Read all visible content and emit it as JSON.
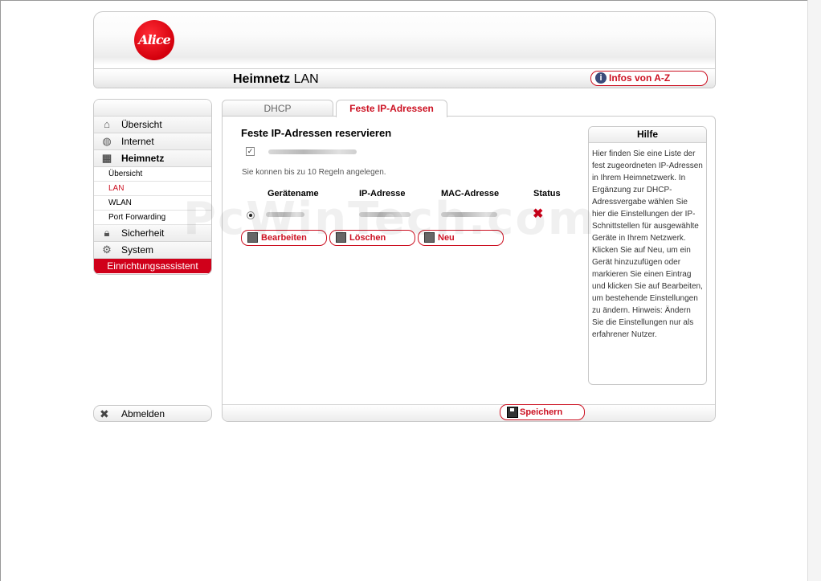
{
  "header": {
    "logo_text": "Alice",
    "title_bold": "Heimnetz",
    "title_rest": " LAN",
    "infos_label": "Infos von A-Z"
  },
  "sidebar": {
    "items": [
      {
        "label": "Übersicht",
        "icon": "home-icon"
      },
      {
        "label": "Internet",
        "icon": "globe-icon"
      },
      {
        "label": "Heimnetz",
        "icon": "network-icon"
      }
    ],
    "subitems": [
      "Übersicht",
      "LAN",
      "WLAN",
      "Port Forwarding"
    ],
    "items2": [
      {
        "label": "Sicherheit",
        "icon": "lock-icon"
      },
      {
        "label": "System",
        "icon": "gear-icon"
      }
    ],
    "wizard_label": "Einrichtungsassistent",
    "logout_label": "Abmelden"
  },
  "tabs": {
    "dhcp": "DHCP",
    "fixed": "Feste IP-Adressen"
  },
  "main": {
    "section_title": "Feste IP-Adressen reservieren",
    "hint": "Sie konnen bis zu 10 Regeln angelegen.",
    "columns": [
      "Gerätename",
      "IP-Adresse",
      "MAC-Adresse",
      "Status"
    ],
    "buttons": {
      "edit": "Bearbeiten",
      "delete": "Löschen",
      "new": "Neu",
      "save": "Speichern"
    }
  },
  "help": {
    "title": "Hilfe",
    "text": "Hier finden Sie eine Liste der fest zugeordneten IP-Adressen in Ihrem Heimnetzwerk. In Ergänzung zur DHCP-Adressvergabe wählen Sie hier die Einstellungen der IP-Schnittstellen für ausgewählte Geräte in Ihrem Netzwerk. Klicken Sie auf Neu, um ein Gerät hinzuzufügen oder markieren Sie einen Eintrag und klicken Sie auf Bearbeiten, um bestehende Einstellungen zu ändern. Hinweis: Ändern Sie die Einstellungen nur als erfahrener Nutzer."
  },
  "watermark": "PcWinTech.com",
  "colors": {
    "accent": "#cc1122",
    "wizard_bg": "#d0001a"
  }
}
